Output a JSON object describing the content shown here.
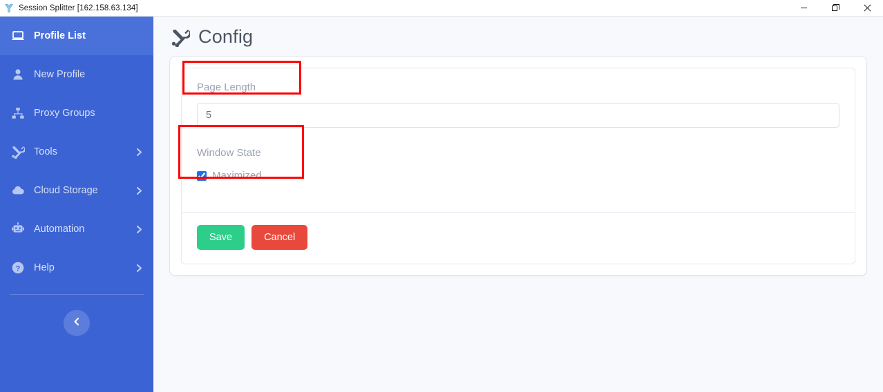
{
  "titlebar": {
    "app_icon": "session-splitter-logo-icon",
    "title": "Session Splitter [162.158.63.134]",
    "minimize_label": "–",
    "restore_label": "❐",
    "close_label": "✕"
  },
  "sidebar": {
    "background_color": "#3b63d4",
    "items": [
      {
        "label": "Profile List",
        "icon": "laptop-icon",
        "active": true,
        "has_chevron": false
      },
      {
        "label": "New Profile",
        "icon": "user-icon",
        "active": false,
        "has_chevron": false
      },
      {
        "label": "Proxy Groups",
        "icon": "sitemap-icon",
        "active": false,
        "has_chevron": false
      },
      {
        "label": "Tools",
        "icon": "tools-icon",
        "active": false,
        "has_chevron": true
      },
      {
        "label": "Cloud Storage",
        "icon": "cloud-icon",
        "active": false,
        "has_chevron": true
      },
      {
        "label": "Automation",
        "icon": "robot-icon",
        "active": false,
        "has_chevron": true
      },
      {
        "label": "Help",
        "icon": "question-mark-icon",
        "active": false,
        "has_chevron": true
      }
    ],
    "collapse_button": {
      "icon": "chevron-left-icon"
    }
  },
  "main": {
    "page_icon": "tools-icon",
    "page_title": "Config",
    "form": {
      "page_length": {
        "label": "Page Length",
        "value": "5",
        "placeholder": "Page Length"
      },
      "window_state": {
        "label": "Window State",
        "checkbox_label": "Maximized",
        "checked": true
      }
    },
    "buttons": {
      "save_label": "Save",
      "save_color": "#2dce89",
      "cancel_label": "Cancel",
      "cancel_color": "#e8493b"
    }
  },
  "annotations": {
    "highlight_color": "#ff0000",
    "boxes": [
      {
        "name": "page-length-highlight",
        "target": "Page Length"
      },
      {
        "name": "window-state-highlight",
        "target": "Window State"
      }
    ]
  }
}
